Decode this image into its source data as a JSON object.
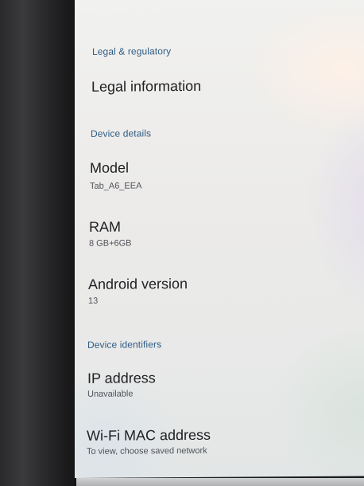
{
  "sections": [
    {
      "header": "Legal & regulatory",
      "items": [
        {
          "title": "Legal information",
          "summary": ""
        }
      ]
    },
    {
      "header": "Device details",
      "items": [
        {
          "title": "Model",
          "summary": "Tab_A6_EEA"
        },
        {
          "title": "RAM",
          "summary": "8 GB+6GB"
        },
        {
          "title": "Android version",
          "summary": "13"
        }
      ]
    },
    {
      "header": "Device identifiers",
      "items": [
        {
          "title": "IP address",
          "summary": "Unavailable"
        },
        {
          "title": "Wi-Fi MAC address",
          "summary": "To view, choose saved network"
        }
      ]
    }
  ]
}
